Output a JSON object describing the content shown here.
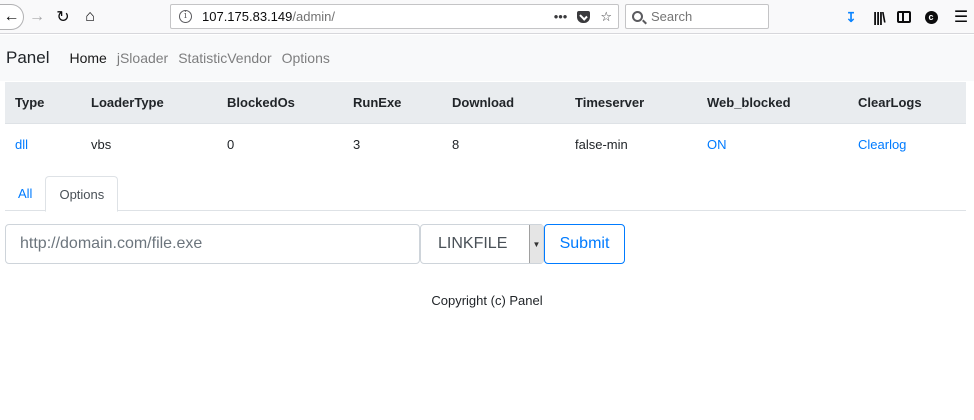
{
  "browser": {
    "url_host": "107.175.83.149",
    "url_path": "/admin/",
    "url_more": "•••",
    "search_placeholder": "Search",
    "icons": [
      "back-icon",
      "forward-icon",
      "reload-icon",
      "home-icon",
      "info-icon",
      "pocket-icon",
      "bookmark-star-icon",
      "search-icon",
      "download-icon",
      "library-icon",
      "sidebar-icon",
      "extension-icon",
      "menu-icon"
    ]
  },
  "navbar": {
    "brand": "Panel",
    "links": [
      "Home",
      "jSloader",
      "StatisticVendor",
      "Options"
    ]
  },
  "table": {
    "headers": [
      "Type",
      "LoaderType",
      "BlockedOs",
      "RunExe",
      "Download",
      "Timeserver",
      "Web_blocked",
      "ClearLogs"
    ],
    "rows": [
      [
        "dll",
        "vbs",
        "0",
        "3",
        "8",
        "false-min",
        "ON",
        "Clearlog"
      ]
    ]
  },
  "tabs": [
    "All",
    "Options"
  ],
  "form": {
    "url_placeholder": "http://domain.com/file.exe",
    "select_value": "LINKFILE",
    "submit_label": "Submit"
  },
  "footer": {
    "copyright": "Copyright (c) Panel"
  },
  "colors": {
    "link": "#007bff",
    "header_bg": "#e9ecef",
    "navbar_bg": "#f8f9fa"
  }
}
